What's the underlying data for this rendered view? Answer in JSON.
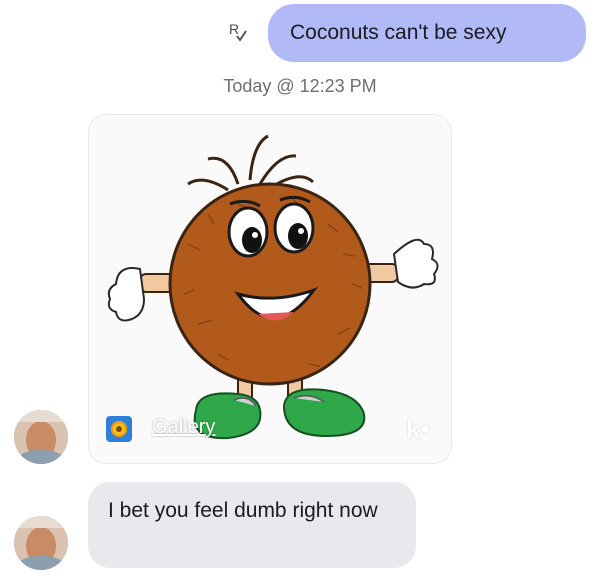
{
  "conversation": {
    "outgoing_message": {
      "text": "Coconuts can't be sexy",
      "bubble_color": "#b1b9f7",
      "receipt_icon": "read-receipt-r-check-icon"
    },
    "timestamp": "Today @ 12:23 PM",
    "shared_card": {
      "source_label": "Gallery",
      "source_icon": "sunflower-gallery-icon",
      "brand_icon": "kik-logo-icon",
      "brand_text": "k•",
      "image_subject": "cartoon-coconut-icon"
    },
    "incoming_message": {
      "text": "I bet you feel dumb right now",
      "bubble_color": "#e9e9ed"
    },
    "contact_avatar_icon": "contact-avatar-photo"
  }
}
